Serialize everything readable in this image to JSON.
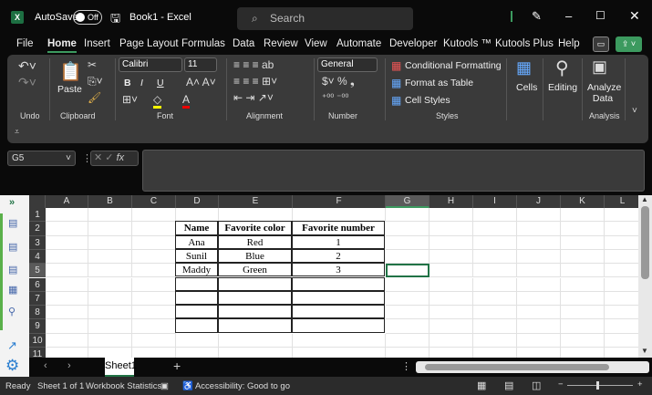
{
  "titlebar": {
    "logo": "X",
    "autosave_label": "AutoSave",
    "autosave_state": "Off",
    "doc_title": "Book1 - Excel",
    "search_placeholder": "Search"
  },
  "tabs": [
    "File",
    "Home",
    "Insert",
    "Page Layout",
    "Formulas",
    "Data",
    "Review",
    "View",
    "Automate",
    "Developer",
    "Kutools ™",
    "Kutools Plus",
    "Help"
  ],
  "ribbon": {
    "groups": [
      "Undo",
      "Clipboard",
      "Font",
      "Alignment",
      "Number",
      "Styles",
      "Analysis"
    ],
    "paste": "Paste",
    "font_name": "Calibri",
    "font_size": "11",
    "number_format": "General",
    "conditional_formatting": "Conditional Formatting",
    "format_as_table": "Format as Table",
    "cell_styles": "Cell Styles",
    "cells": "Cells",
    "editing": "Editing",
    "analyze_data": "Analyze Data",
    "bold": "B",
    "italic": "I",
    "underline": "U"
  },
  "formula_bar": {
    "name_box": "G5",
    "fx": "fx",
    "value": ""
  },
  "sheet": {
    "columns": [
      "A",
      "B",
      "C",
      "D",
      "E",
      "F",
      "G",
      "H",
      "I",
      "J",
      "K",
      "L"
    ],
    "rows": [
      "1",
      "2",
      "3",
      "4",
      "5",
      "6",
      "7",
      "8",
      "9",
      "10",
      "11"
    ],
    "selected_cell": "G5",
    "table": {
      "headers": [
        "Name",
        "Favorite color",
        "Favorite number"
      ],
      "data": [
        [
          "Ana",
          "Red",
          "1"
        ],
        [
          "Sunil",
          "Blue",
          "2"
        ],
        [
          "Maddy",
          "Green",
          "3"
        ],
        [
          "",
          "",
          ""
        ],
        [
          "",
          "",
          ""
        ],
        [
          "",
          "",
          ""
        ],
        [
          "",
          "",
          ""
        ]
      ]
    }
  },
  "sheet_tabs": [
    "Sheet1"
  ],
  "status": {
    "ready": "Ready",
    "sheet_of": "Sheet 1 of 1",
    "workbook_stats": "Workbook Statistics",
    "accessibility": "Accessibility: Good to go"
  },
  "colors": {
    "accent": "#217346",
    "share": "#3c9a5f"
  }
}
